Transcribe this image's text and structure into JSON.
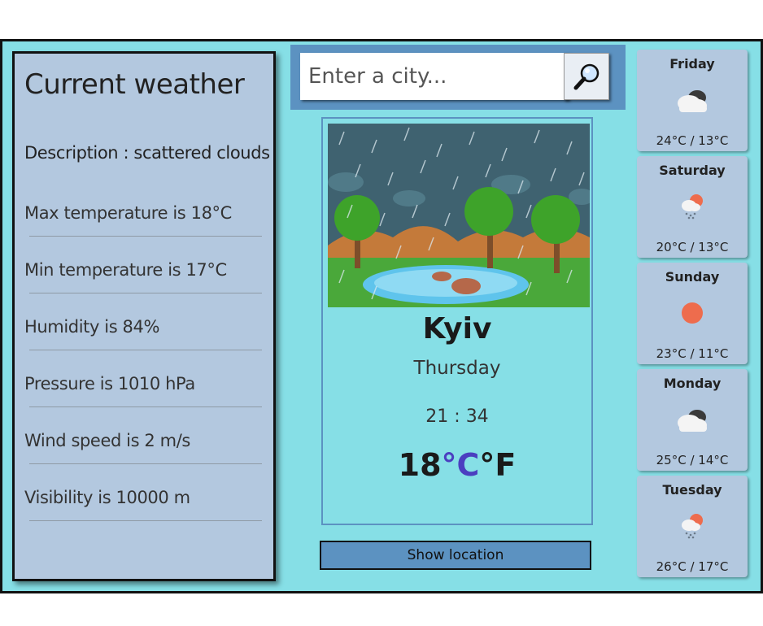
{
  "current": {
    "title": "Current weather",
    "description": "Description : scattered clouds",
    "stats": [
      "Max temperature is 18°C",
      "Min temperature is 17°C",
      "Humidity is 84%",
      "Pressure is 1010 hPa",
      "Wind speed is 2 m/s",
      "Visibility is 10000 m"
    ]
  },
  "search": {
    "placeholder": "Enter a city..."
  },
  "main": {
    "city": "Kyiv",
    "day": "Thursday",
    "time": "21 : 34",
    "temp_value": "18",
    "unit_c": "°C",
    "unit_f": "°F",
    "show_location_label": "Show location"
  },
  "forecast": [
    {
      "day": "Friday",
      "icon": "cloudy-icon",
      "range": "24°C / 13°C"
    },
    {
      "day": "Saturday",
      "icon": "rain-sun-icon",
      "range": "20°C / 13°C"
    },
    {
      "day": "Sunday",
      "icon": "sun-icon",
      "range": "23°C / 11°C"
    },
    {
      "day": "Monday",
      "icon": "cloudy-icon",
      "range": "25°C / 14°C"
    },
    {
      "day": "Tuesday",
      "icon": "rain-sun-icon",
      "range": "26°C / 17°C"
    }
  ],
  "colors": {
    "background": "#86dfe6",
    "panel": "#b3c8df",
    "accent": "#5c92c1",
    "celsius": "#4b3fc0",
    "sun": "#ee6c4d"
  }
}
